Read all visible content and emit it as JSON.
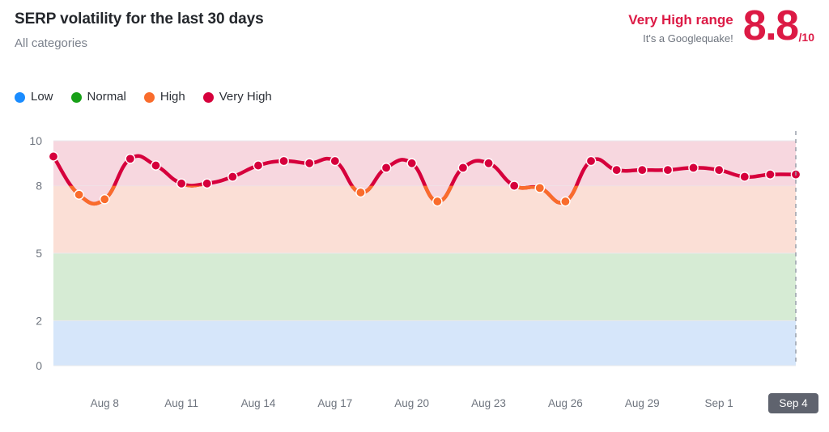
{
  "header": {
    "title": "SERP volatility for the last 30 days",
    "subtitle": "All categories",
    "range_label": "Very High range",
    "range_sub": "It's a Googlequake!",
    "score": "8.8",
    "score_denominator": "/10"
  },
  "legend": {
    "items": [
      {
        "label": "Low",
        "color": "#1a8cff"
      },
      {
        "label": "Normal",
        "color": "#18a018"
      },
      {
        "label": "High",
        "color": "#f96c2c"
      },
      {
        "label": "Very High",
        "color": "#d6003c"
      }
    ]
  },
  "colors": {
    "very_high_line": "#d6003c",
    "high_line": "#f96c2c",
    "band_low": "#d6e6fa",
    "band_normal": "#d6ebd4",
    "band_high": "#fbdfd6",
    "band_very_high": "#f7d7df",
    "gridline": "#e8e9ec",
    "axis_text": "#6e747e",
    "active_tick_bg": "#5f636e"
  },
  "chart_data": {
    "type": "line",
    "title": "SERP volatility for the last 30 days",
    "subtitle": "All categories",
    "xlabel": "",
    "ylabel": "",
    "ylim": [
      0,
      10
    ],
    "yticks": [
      0,
      2,
      5,
      8,
      10
    ],
    "grid": false,
    "legend_position": "top-left",
    "bands": [
      {
        "name": "Low",
        "from": 0,
        "to": 2,
        "color": "#d6e6fa"
      },
      {
        "name": "Normal",
        "from": 2,
        "to": 5,
        "color": "#d6ebd4"
      },
      {
        "name": "High",
        "from": 5,
        "to": 8,
        "color": "#fbdfd6"
      },
      {
        "name": "Very High",
        "from": 8,
        "to": 10,
        "color": "#f7d7df"
      }
    ],
    "threshold_very_high": 8,
    "x": [
      "Aug 6",
      "Aug 7",
      "Aug 8",
      "Aug 9",
      "Aug 10",
      "Aug 11",
      "Aug 12",
      "Aug 13",
      "Aug 14",
      "Aug 15",
      "Aug 16",
      "Aug 17",
      "Aug 18",
      "Aug 19",
      "Aug 20",
      "Aug 21",
      "Aug 22",
      "Aug 23",
      "Aug 24",
      "Aug 25",
      "Aug 26",
      "Aug 27",
      "Aug 28",
      "Aug 29",
      "Aug 30",
      "Aug 31",
      "Sep 1",
      "Sep 2",
      "Sep 3",
      "Sep 4"
    ],
    "xticks": [
      "Aug 8",
      "Aug 11",
      "Aug 14",
      "Aug 17",
      "Aug 20",
      "Aug 23",
      "Aug 26",
      "Aug 29",
      "Sep 1",
      "Sep 4"
    ],
    "xtick_active": "Sep 4",
    "values": [
      9.3,
      7.6,
      7.4,
      9.2,
      8.9,
      8.1,
      8.1,
      8.4,
      8.9,
      9.1,
      9.0,
      9.1,
      7.7,
      8.8,
      9.0,
      7.3,
      8.8,
      9.0,
      8.0,
      7.9,
      7.3,
      9.1,
      8.7,
      8.7,
      8.7,
      8.8,
      8.7,
      8.4,
      8.5,
      8.5
    ],
    "series": [
      {
        "name": "SERP volatility",
        "values": [
          9.3,
          7.6,
          7.4,
          9.2,
          8.9,
          8.1,
          8.1,
          8.4,
          8.9,
          9.1,
          9.0,
          9.1,
          7.7,
          8.8,
          9.0,
          7.3,
          8.8,
          9.0,
          8.0,
          7.9,
          7.3,
          9.1,
          8.7,
          8.7,
          8.7,
          8.8,
          8.7,
          8.4,
          8.5,
          8.5
        ]
      }
    ],
    "marker_colors": [
      "#d6003c",
      "#f96c2c",
      "#f96c2c",
      "#d6003c",
      "#d6003c",
      "#d6003c",
      "#d6003c",
      "#d6003c",
      "#d6003c",
      "#d6003c",
      "#d6003c",
      "#d6003c",
      "#f96c2c",
      "#d6003c",
      "#d6003c",
      "#f96c2c",
      "#d6003c",
      "#d6003c",
      "#d6003c",
      "#f96c2c",
      "#f96c2c",
      "#d6003c",
      "#d6003c",
      "#d6003c",
      "#d6003c",
      "#d6003c",
      "#d6003c",
      "#d6003c",
      "#d6003c",
      "#d6003c"
    ]
  }
}
